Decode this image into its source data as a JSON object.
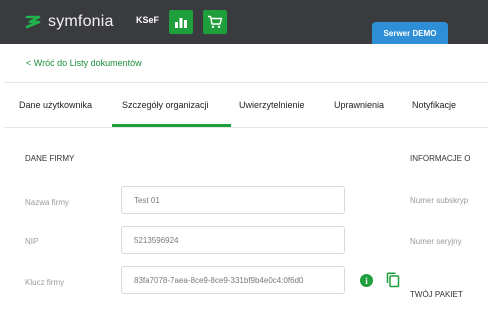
{
  "header": {
    "logo_text": "symfonia",
    "module_label": "KSeF",
    "server_tab_label": "Serwer DEMO",
    "accent": "#1f9e3c",
    "server_tab_color": "#2f8fd6",
    "bar_color": "#3a3b3e",
    "icons": [
      "bar-chart-icon",
      "cart-icon"
    ]
  },
  "page": {
    "back_link": "< Wróć do Listy dokumentów",
    "tabs": [
      {
        "label": "Dane użytkownika"
      },
      {
        "label": "Szczegóły organizacji",
        "active": true
      },
      {
        "label": "Uwierzytelnienie"
      },
      {
        "label": "Uprawnienia"
      },
      {
        "label": "Notyfikacje"
      }
    ]
  },
  "company": {
    "section_title": "DANE FIRMY",
    "name_label": "Nazwa firmy",
    "name_value": "Test 01",
    "nip_label": "NIP",
    "nip_value": "5213596924",
    "key_label": "Klucz firmy",
    "key_value": "83fa7078-7aea-8ce9-8ce9-331bf9b4e0c4:0f6d0"
  },
  "info": {
    "section_title": "INFORMACJE O",
    "subscription_label": "Numer subskryp",
    "serial_label": "Numer seryjny",
    "package_title": "TWÓJ PAKIET"
  }
}
